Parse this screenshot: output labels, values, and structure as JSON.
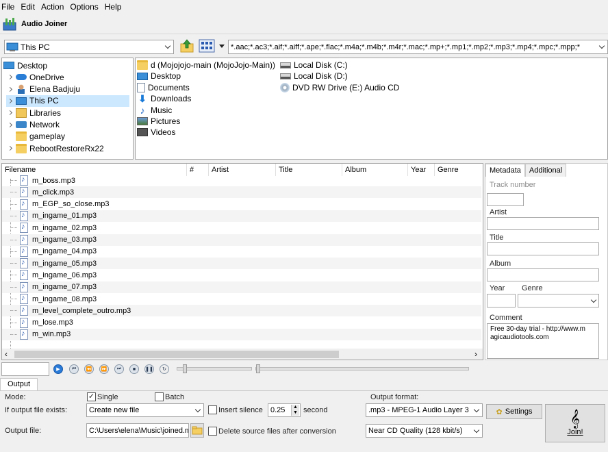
{
  "menu": [
    "File",
    "Edit",
    "Action",
    "Options",
    "Help"
  ],
  "toolbar": {
    "title": "Audio Joiner"
  },
  "address": {
    "location": "This PC",
    "filter": "*.aac;*.ac3;*.aif;*.aiff;*.ape;*.flac;*.m4a;*.m4b;*.m4r;*.mac;*.mp+;*.mp1;*.mp2;*.mp3;*.mp4;*.mpc;*.mpp;*"
  },
  "tree": [
    {
      "label": "Desktop",
      "icon": "desktop-icon",
      "expand": false,
      "indent": 0
    },
    {
      "label": "OneDrive",
      "icon": "cloud-icon",
      "expand": true,
      "indent": 1
    },
    {
      "label": "Elena Badjuju",
      "icon": "user-icon",
      "expand": true,
      "indent": 1
    },
    {
      "label": "This PC",
      "icon": "pc-icon",
      "expand": true,
      "indent": 1,
      "selected": true
    },
    {
      "label": "Libraries",
      "icon": "library-icon",
      "expand": true,
      "indent": 1
    },
    {
      "label": "Network",
      "icon": "network-icon",
      "expand": true,
      "indent": 1
    },
    {
      "label": "gameplay",
      "icon": "folder-icon",
      "expand": false,
      "indent": 1
    },
    {
      "label": "RebootRestoreRx22",
      "icon": "folder-icon",
      "expand": true,
      "indent": 1
    }
  ],
  "folders_col1": [
    {
      "label": "d (Mojojojo-main (MojoJojo-Main))",
      "icon": "network-drive-icon"
    },
    {
      "label": "Desktop",
      "icon": "desktop-icon"
    },
    {
      "label": "Documents",
      "icon": "documents-icon"
    },
    {
      "label": "Downloads",
      "icon": "downloads-icon"
    },
    {
      "label": "Music",
      "icon": "music-icon"
    },
    {
      "label": "Pictures",
      "icon": "pictures-icon"
    },
    {
      "label": "Videos",
      "icon": "videos-icon"
    }
  ],
  "folders_col2": [
    {
      "label": "Local Disk (C:)",
      "icon": "drive-icon"
    },
    {
      "label": "Local Disk (D:)",
      "icon": "drive-icon"
    },
    {
      "label": "DVD RW Drive (E:) Audio CD",
      "icon": "dvd-icon"
    }
  ],
  "grid": {
    "headers": [
      "Filename",
      "#",
      "Artist",
      "Title",
      "Album",
      "Year",
      "Genre"
    ],
    "files": [
      "m_boss.mp3",
      "m_click.mp3",
      "m_EGP_so_close.mp3",
      "m_ingame_01.mp3",
      "m_ingame_02.mp3",
      "m_ingame_03.mp3",
      "m_ingame_04.mp3",
      "m_ingame_05.mp3",
      "m_ingame_06.mp3",
      "m_ingame_07.mp3",
      "m_ingame_08.mp3",
      "m_level_complete_outro.mp3",
      "m_lose.mp3",
      "m_win.mp3"
    ]
  },
  "metadata": {
    "tabs": [
      "Metadata",
      "Additional"
    ],
    "track_label": "Track number",
    "artist_label": "Artist",
    "title_label": "Title",
    "album_label": "Album",
    "year_label": "Year",
    "genre_label": "Genre",
    "comment_label": "Comment",
    "comment_value": "Free 30-day trial - http://www.magicaudiotools.com"
  },
  "output": {
    "tab": "Output",
    "mode_label": "Mode:",
    "single_label": "Single",
    "batch_label": "Batch",
    "exists_label": "If output file exists:",
    "exists_value": "Create new file",
    "insert_silence_label": "Insert silence",
    "silence_value": "0.25",
    "second_label": "second",
    "outfile_label": "Output file:",
    "outfile_value": "C:\\Users\\elena\\Music\\joined.mp",
    "delete_label": "Delete source files after conversion",
    "format_label": "Output format:",
    "format_value": ".mp3 - MPEG-1 Audio Layer 3",
    "quality_value": "Near CD Quality (128 kbit/s)",
    "settings_label": "Settings",
    "join_label": "Join!"
  },
  "colors": {
    "accent": "#2a7ad8",
    "selection": "#cce8ff"
  }
}
